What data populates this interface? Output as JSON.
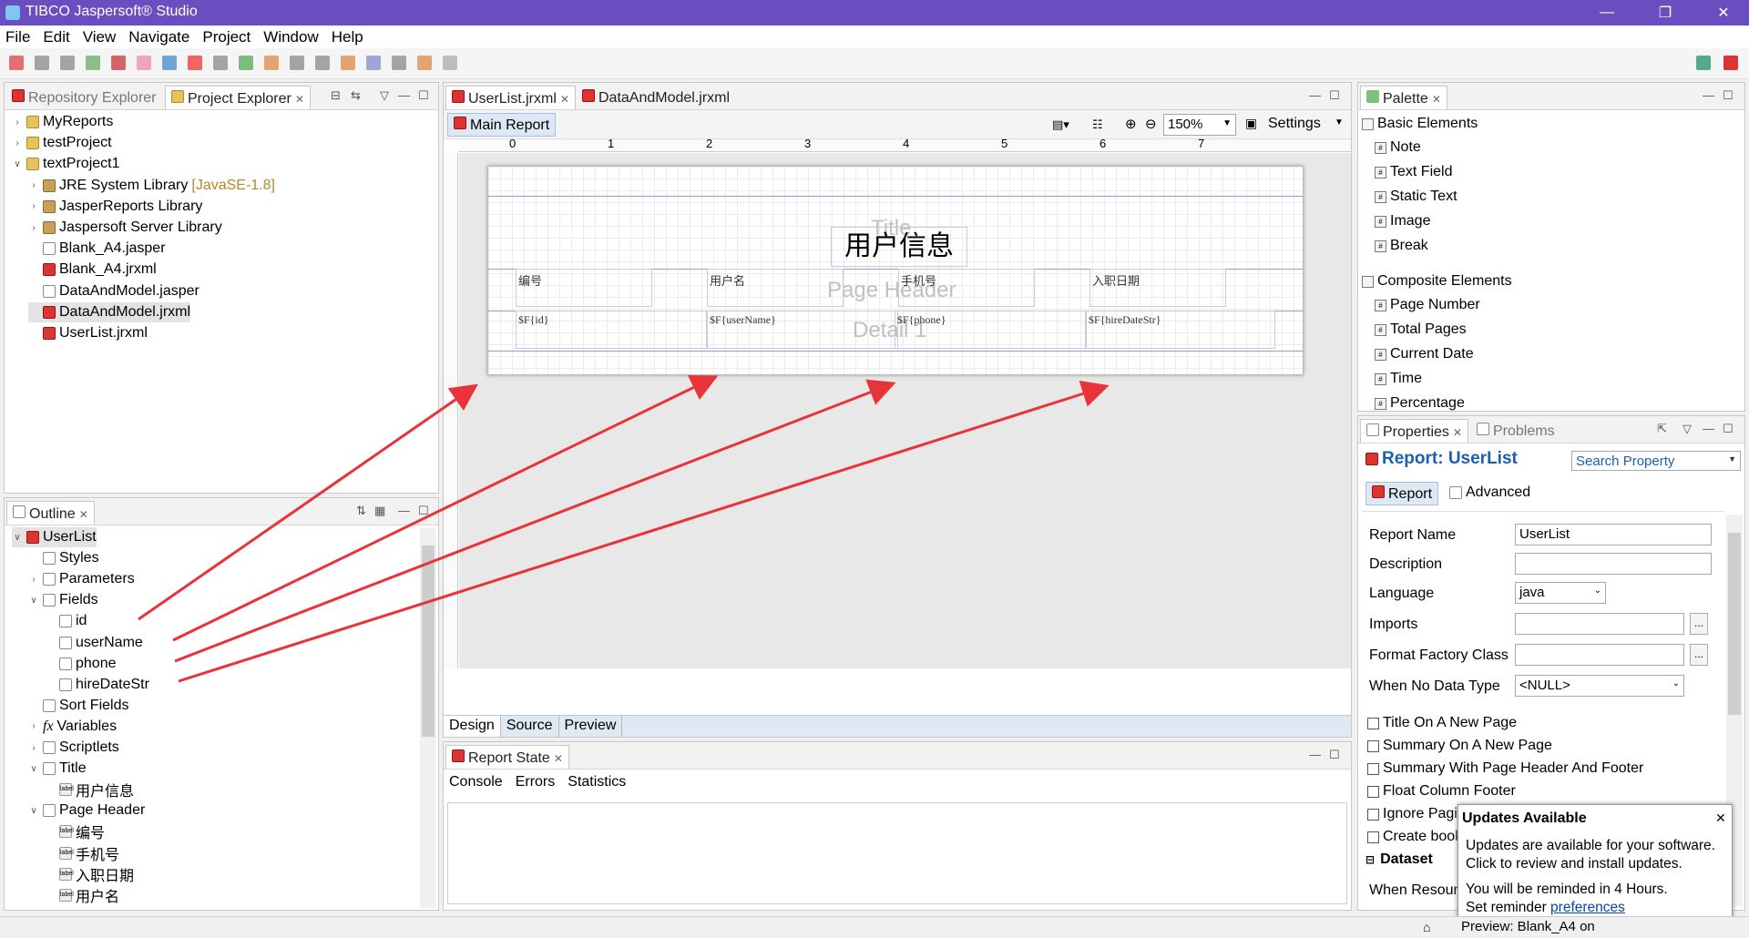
{
  "window": {
    "title": "TIBCO Jaspersoft® Studio"
  },
  "menu": [
    "File",
    "Edit",
    "View",
    "Navigate",
    "Project",
    "Window",
    "Help"
  ],
  "explorer": {
    "tabs": [
      "Repository Explorer",
      "Project Explorer"
    ],
    "tree": [
      {
        "label": "MyReports",
        "indent": 0,
        "tw": ">",
        "icon": "folder"
      },
      {
        "label": "testProject",
        "indent": 0,
        "tw": ">",
        "icon": "folder"
      },
      {
        "label": "textProject1",
        "indent": 0,
        "tw": "v",
        "icon": "folder"
      },
      {
        "label": "JRE System Library",
        "suffix": "[JavaSE-1.8]",
        "indent": 1,
        "tw": ">",
        "icon": "lib"
      },
      {
        "label": "JasperReports Library",
        "indent": 1,
        "tw": ">",
        "icon": "lib"
      },
      {
        "label": "Jaspersoft Server Library",
        "indent": 1,
        "tw": ">",
        "icon": "lib"
      },
      {
        "label": "Blank_A4.jasper",
        "indent": 1,
        "tw": "",
        "icon": "file"
      },
      {
        "label": "Blank_A4.jrxml",
        "indent": 1,
        "tw": "",
        "icon": "rep"
      },
      {
        "label": "DataAndModel.jasper",
        "indent": 1,
        "tw": "",
        "icon": "file"
      },
      {
        "label": "DataAndModel.jrxml",
        "indent": 1,
        "tw": "",
        "icon": "rep",
        "selected": true
      },
      {
        "label": "UserList.jrxml",
        "indent": 1,
        "tw": "",
        "icon": "rep"
      }
    ]
  },
  "outline": {
    "tab": "Outline",
    "tree": [
      {
        "label": "UserList",
        "indent": 0,
        "tw": "v",
        "icon": "rep",
        "selected": true
      },
      {
        "label": "Styles",
        "indent": 1,
        "tw": "",
        "icon": "file"
      },
      {
        "label": "Parameters",
        "indent": 1,
        "tw": ">",
        "icon": "file"
      },
      {
        "label": "Fields",
        "indent": 1,
        "tw": "v",
        "icon": "file"
      },
      {
        "label": "id",
        "indent": 2,
        "tw": "",
        "icon": "file"
      },
      {
        "label": "userName",
        "indent": 2,
        "tw": "",
        "icon": "file"
      },
      {
        "label": "phone",
        "indent": 2,
        "tw": "",
        "icon": "file"
      },
      {
        "label": "hireDateStr",
        "indent": 2,
        "tw": "",
        "icon": "file"
      },
      {
        "label": "Sort Fields",
        "indent": 1,
        "tw": "",
        "icon": "file"
      },
      {
        "label": "Variables",
        "indent": 1,
        "tw": ">",
        "icon": "file",
        "fx": true
      },
      {
        "label": "Scriptlets",
        "indent": 1,
        "tw": ">",
        "icon": "file"
      },
      {
        "label": "Title",
        "indent": 1,
        "tw": "v",
        "icon": "file"
      },
      {
        "label": "用户信息",
        "indent": 2,
        "tw": "",
        "icon": "lbl"
      },
      {
        "label": "Page Header",
        "indent": 1,
        "tw": "v",
        "icon": "file"
      },
      {
        "label": "编号",
        "indent": 2,
        "tw": "",
        "icon": "lbl"
      },
      {
        "label": "手机号",
        "indent": 2,
        "tw": "",
        "icon": "lbl"
      },
      {
        "label": "入职日期",
        "indent": 2,
        "tw": "",
        "icon": "lbl"
      },
      {
        "label": "用户名",
        "indent": 2,
        "tw": "",
        "icon": "lbl"
      }
    ]
  },
  "editor": {
    "tabs": [
      "UserList.jrxml",
      "DataAndModel.jrxml"
    ],
    "subtab": "Main Report",
    "zoom": "150%",
    "settings": "Settings",
    "ruler": [
      "0",
      "1",
      "2",
      "3",
      "4",
      "5",
      "6",
      "7"
    ],
    "report": {
      "title_text": "用户信息",
      "band_title": "Title",
      "band_header": "Page Header",
      "band_detail": "Detail 1",
      "headers": [
        "编号",
        "用户名",
        "手机号",
        "入职日期"
      ],
      "fields": [
        "$F{id}",
        "$F{userName}",
        "$F{phone}",
        "$F{hireDateStr}"
      ]
    },
    "bottom_tabs": [
      "Design",
      "Source",
      "Preview"
    ]
  },
  "report_state": {
    "tab": "Report State",
    "subtabs": [
      "Console",
      "Errors",
      "Statistics"
    ]
  },
  "palette": {
    "tab": "Palette",
    "sections": [
      {
        "title": "Basic Elements",
        "items": [
          "Note",
          "Text Field",
          "Static Text",
          "Image",
          "Break"
        ]
      },
      {
        "title": "Composite Elements",
        "items": [
          "Page Number",
          "Total Pages",
          "Current Date",
          "Time",
          "Percentage"
        ]
      }
    ]
  },
  "properties": {
    "tabs": [
      "Properties",
      "Problems"
    ],
    "heading": "Report: UserList",
    "search_placeholder": "Search Property",
    "subtabs": [
      "Report",
      "Advanced"
    ],
    "fields": [
      {
        "label": "Report Name",
        "value": "UserList"
      },
      {
        "label": "Description",
        "value": ""
      },
      {
        "label": "Language",
        "value": "java"
      },
      {
        "label": "Imports",
        "value": ""
      },
      {
        "label": "Format Factory Class",
        "value": ""
      },
      {
        "label": "When No Data Type",
        "value": "<NULL>"
      }
    ],
    "checkboxes": [
      "Title On A New Page",
      "Summary On A New Page",
      "Summary With Page Header And Footer",
      "Float Column Footer",
      "Ignore Pagination",
      "Create bookmarks"
    ],
    "dataset_section": "Dataset",
    "when_resource": "When Resource"
  },
  "notification": {
    "title": "Updates Available",
    "line1": "Updates are available for your software.",
    "line2": "Click to review and install updates.",
    "line3": "You will be reminded in 4 Hours.",
    "line4_prefix": "Set reminder",
    "line4_link": "preferences"
  },
  "statusbar": {
    "text": "Preview: Blank_A4 on"
  },
  "colors": {
    "titlebar": "#6a4ec0",
    "arrow": "#e8333b",
    "heading": "#1a5fb4",
    "link": "#0645ad"
  }
}
